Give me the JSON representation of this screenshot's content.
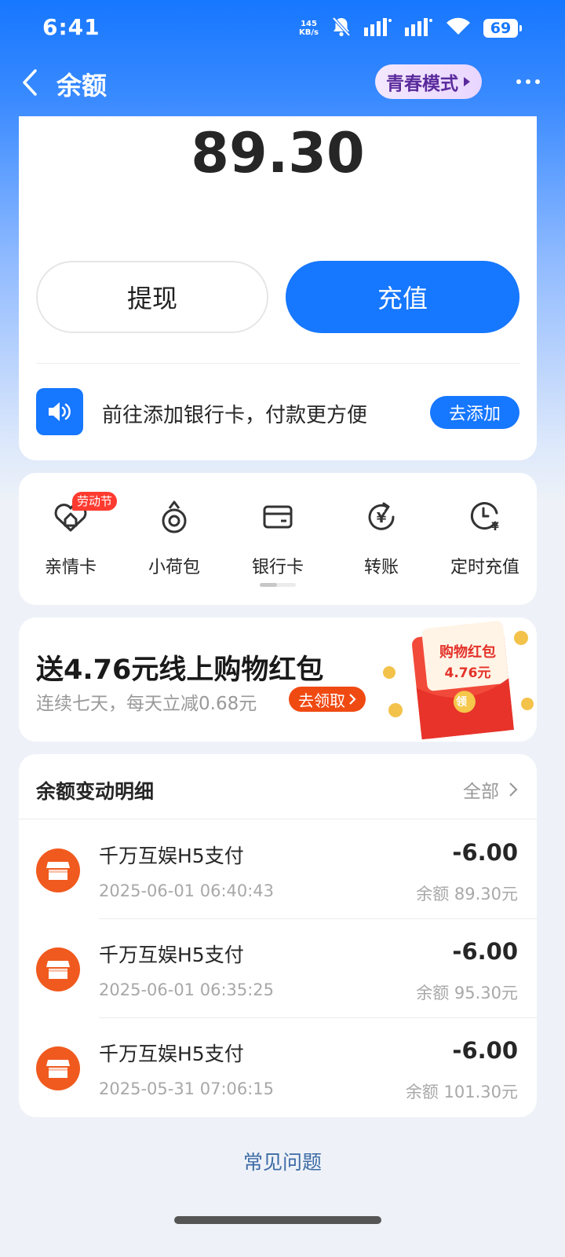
{
  "status_bar": {
    "time": "6:41",
    "net_speed_value": "145",
    "net_speed_unit": "KB/s",
    "battery": "69",
    "icons": [
      "mute-bell-icon",
      "signal-icon",
      "signal-icon",
      "wifi-icon",
      "battery-icon"
    ]
  },
  "nav": {
    "title": "余额",
    "youth_mode": "青春模式",
    "back_icon": "chevron-left-icon",
    "more_icon": "more-dots-icon"
  },
  "balance": {
    "amount": "89.30",
    "withdraw_label": "提现",
    "recharge_label": "充值",
    "bank_tip": "前往添加银行卡，付款更方便",
    "add_label": "去添加"
  },
  "shortcuts": {
    "holiday_tag": "劳动节",
    "items": [
      {
        "label": "亲情卡",
        "icon": "family-card-icon"
      },
      {
        "label": "小荷包",
        "icon": "purse-icon"
      },
      {
        "label": "银行卡",
        "icon": "bank-card-icon"
      },
      {
        "label": "转账",
        "icon": "transfer-yen-icon"
      },
      {
        "label": "定时充值",
        "icon": "clock-yen-icon"
      }
    ],
    "page_index": 1,
    "page_count": 2
  },
  "promo": {
    "title": "送4.76元线上购物红包",
    "subtitle": "连续七天，每天立减0.68元",
    "claim_label": "去领取",
    "redpack_title": "购物红包",
    "redpack_amount": "4.76元",
    "redpack_seal": "领"
  },
  "details": {
    "header": "余额变动明细",
    "all_label": "全部",
    "transactions": [
      {
        "name": "千万互娱H5支付",
        "time": "2025-06-01 06:40:43",
        "amount": "-6.00",
        "balance": "余额 89.30元"
      },
      {
        "name": "千万互娱H5支付",
        "time": "2025-06-01 06:35:25",
        "amount": "-6.00",
        "balance": "余额 95.30元"
      },
      {
        "name": "千万互娱H5支付",
        "time": "2025-05-31 07:06:15",
        "amount": "-6.00",
        "balance": "余额 101.30元"
      }
    ]
  },
  "footer": {
    "faq": "常见问题"
  },
  "colors": {
    "brand_blue": "#1677ff",
    "promo_orange": "#f04a13",
    "shop_orange": "#f05a1e",
    "holiday_red": "#ff3b30"
  }
}
